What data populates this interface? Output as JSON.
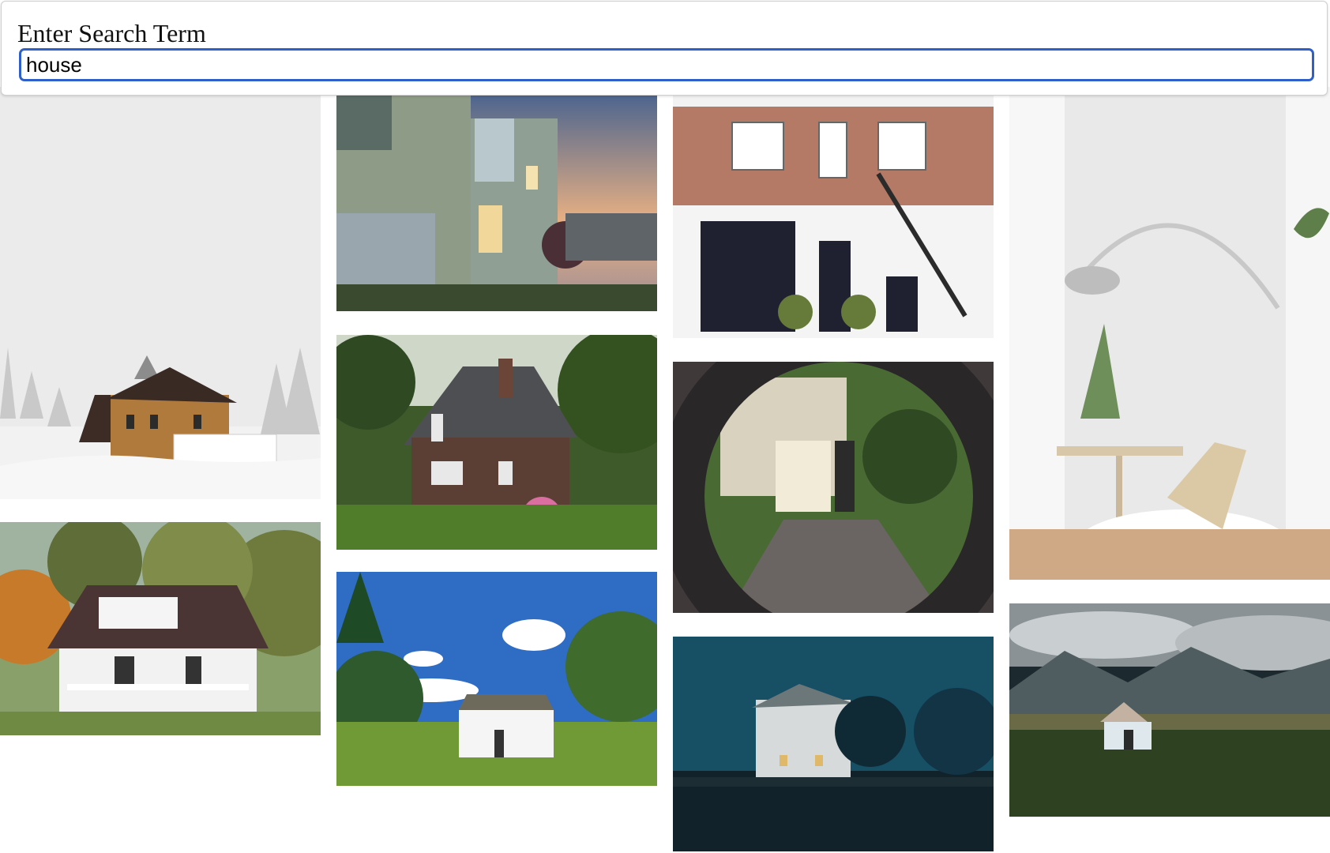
{
  "search": {
    "label": "Enter Search Term",
    "value": "house"
  },
  "gallery": {
    "images": [
      {
        "name": "snowy-victorian-house-photo"
      },
      {
        "name": "modern-house-at-dusk-photo"
      },
      {
        "name": "brick-townhouse-with-garage-photo"
      },
      {
        "name": "white-interior-room-photo"
      },
      {
        "name": "stone-cottage-garden-photo"
      },
      {
        "name": "house-through-lens-photo"
      },
      {
        "name": "white-house-with-porch-photo"
      },
      {
        "name": "small-white-farmhouse-photo"
      },
      {
        "name": "house-at-night-photo"
      },
      {
        "name": "house-in-valley-photo"
      }
    ]
  }
}
